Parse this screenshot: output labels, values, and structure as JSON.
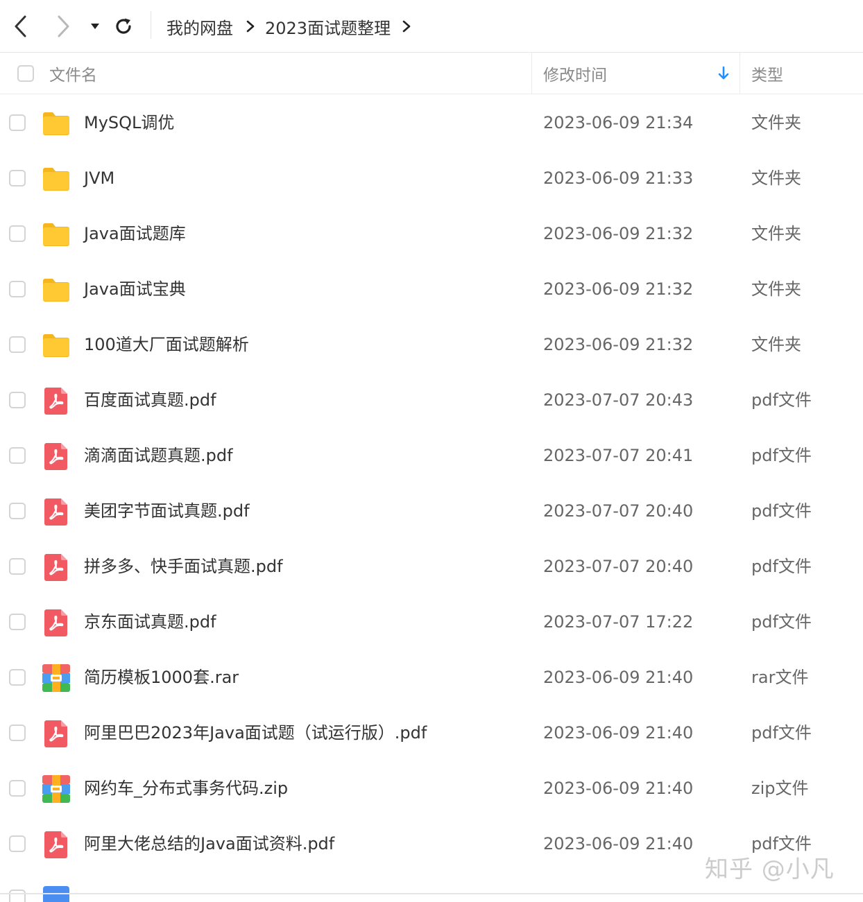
{
  "breadcrumb": [
    "我的网盘",
    "2023面试题整理"
  ],
  "columns": {
    "name": "文件名",
    "modified": "修改时间",
    "type": "类型"
  },
  "sort": {
    "column": "modified",
    "direction": "descending"
  },
  "files": [
    {
      "name": "MySQL调优",
      "modified": "2023-06-09 21:34",
      "type": "文件夹",
      "icon": "folder-icon"
    },
    {
      "name": "JVM",
      "modified": "2023-06-09 21:33",
      "type": "文件夹",
      "icon": "folder-icon"
    },
    {
      "name": "Java面试题库",
      "modified": "2023-06-09 21:32",
      "type": "文件夹",
      "icon": "folder-icon"
    },
    {
      "name": "Java面试宝典",
      "modified": "2023-06-09 21:32",
      "type": "文件夹",
      "icon": "folder-icon"
    },
    {
      "name": "100道大厂面试题解析",
      "modified": "2023-06-09 21:32",
      "type": "文件夹",
      "icon": "folder-icon"
    },
    {
      "name": "百度面试真题.pdf",
      "modified": "2023-07-07 20:43",
      "type": "pdf文件",
      "icon": "pdf-icon"
    },
    {
      "name": "滴滴面试题真题.pdf",
      "modified": "2023-07-07 20:41",
      "type": "pdf文件",
      "icon": "pdf-icon"
    },
    {
      "name": "美团字节面试真题.pdf",
      "modified": "2023-07-07 20:40",
      "type": "pdf文件",
      "icon": "pdf-icon"
    },
    {
      "name": "拼多多、快手面试真题.pdf",
      "modified": "2023-07-07 20:40",
      "type": "pdf文件",
      "icon": "pdf-icon"
    },
    {
      "name": "京东面试真题.pdf",
      "modified": "2023-07-07 17:22",
      "type": "pdf文件",
      "icon": "pdf-icon"
    },
    {
      "name": "简历模板1000套.rar",
      "modified": "2023-06-09 21:40",
      "type": "rar文件",
      "icon": "archive-icon"
    },
    {
      "name": "阿里巴巴2023年Java面试题（试运行版）.pdf",
      "modified": "2023-06-09 21:40",
      "type": "pdf文件",
      "icon": "pdf-icon"
    },
    {
      "name": "网约车_分布式事务代码.zip",
      "modified": "2023-06-09 21:40",
      "type": "zip文件",
      "icon": "archive-icon"
    },
    {
      "name": "阿里大佬总结的Java面试资料.pdf",
      "modified": "2023-06-09 21:40",
      "type": "pdf文件",
      "icon": "pdf-icon"
    }
  ],
  "watermark": "知乎 @小凡",
  "colors": {
    "folder": "#FFC933",
    "pdf": "#F25A63",
    "sort_arrow": "#1E90FF",
    "archive_top": "#F06464",
    "archive_mid": "#4A9DF0",
    "archive_bottom": "#3FB950",
    "archive_band": "#FFB020"
  }
}
